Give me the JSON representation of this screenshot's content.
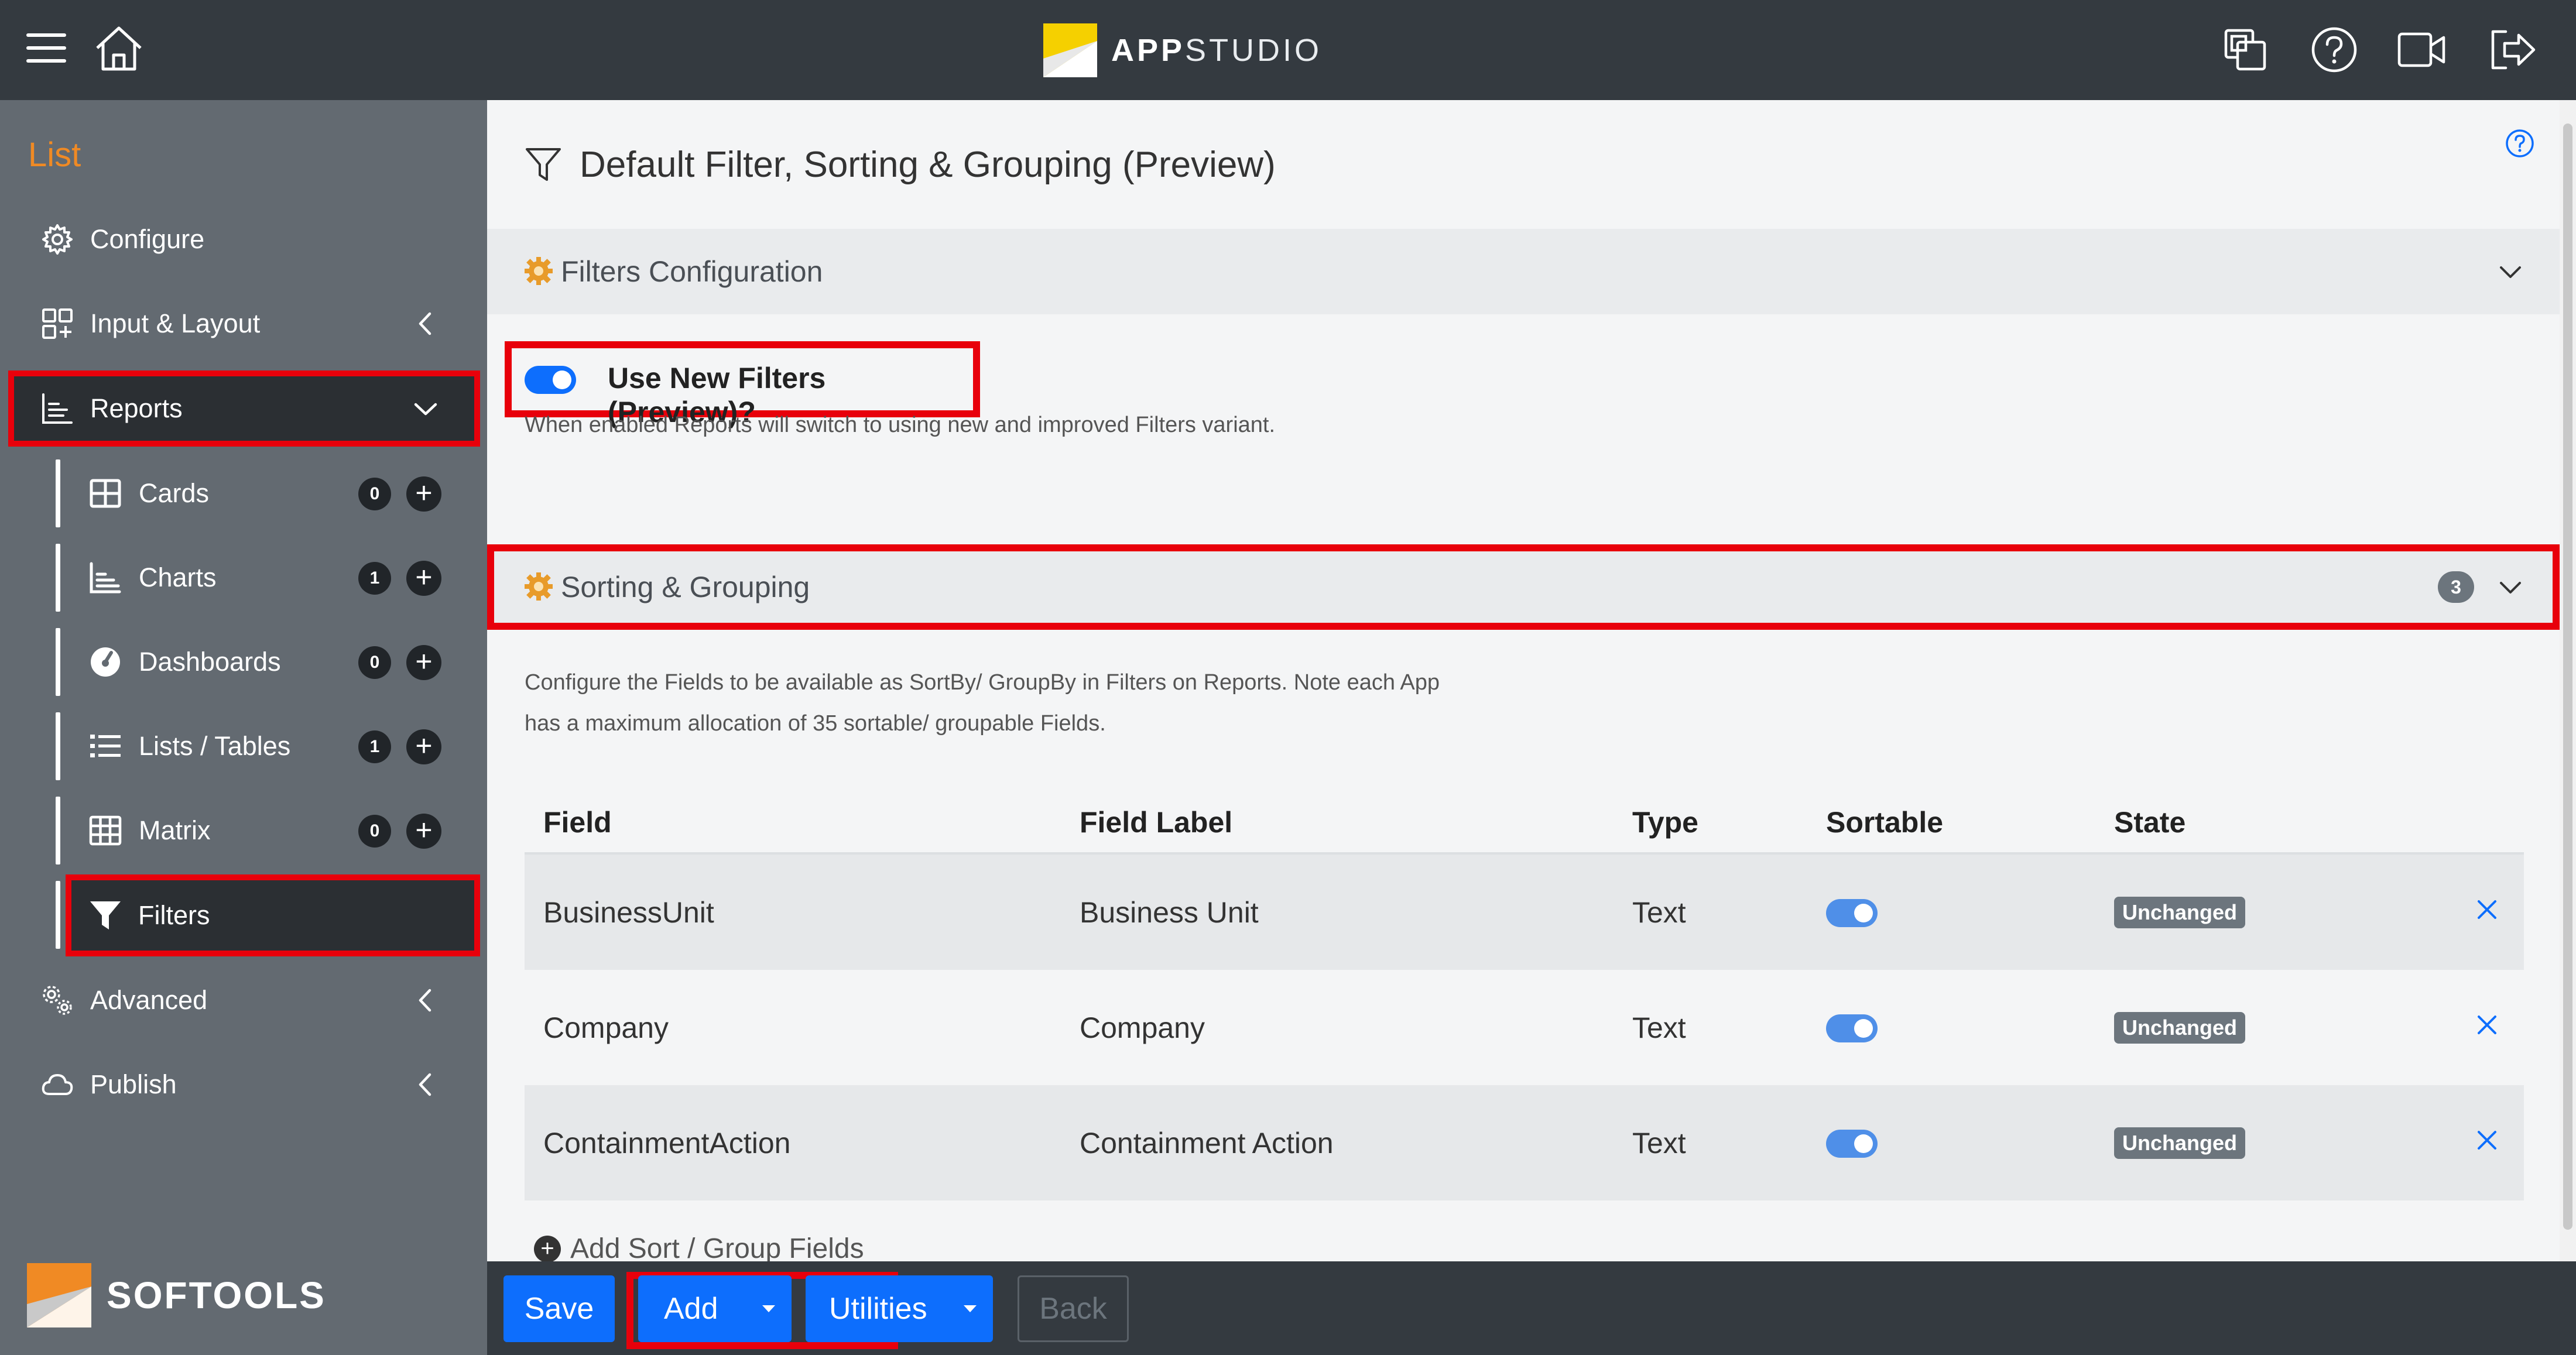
{
  "header": {
    "brand_bold": "APP",
    "brand_rest": "STUDIO",
    "icons": [
      "menu-icon",
      "home-icon",
      "copy-icon",
      "help-icon",
      "video-icon",
      "logout-icon"
    ],
    "brand_colors": {
      "yellow": "#f5d000",
      "white": "#ffffff"
    }
  },
  "sidebar": {
    "title": "List",
    "items": [
      {
        "label": "Configure",
        "icon": "gear-icon"
      },
      {
        "label": "Input & Layout",
        "icon": "layout-icon"
      },
      {
        "label": "Reports",
        "icon": "chart-icon"
      }
    ],
    "sub_items": [
      {
        "label": "Cards",
        "count": "0",
        "icon": "cards-icon"
      },
      {
        "label": "Charts",
        "count": "1",
        "icon": "chart-icon"
      },
      {
        "label": "Dashboards",
        "count": "0",
        "icon": "dashboard-icon"
      },
      {
        "label": "Lists / Tables",
        "count": "1",
        "icon": "list-icon"
      },
      {
        "label": "Matrix",
        "count": "0",
        "icon": "matrix-icon"
      },
      {
        "label": "Filters",
        "icon": "filter-icon"
      }
    ],
    "bottom_items": [
      {
        "label": "Advanced",
        "icon": "gears-icon"
      },
      {
        "label": "Publish",
        "icon": "cloud-icon"
      }
    ],
    "logo_text": "SOFTOOLS",
    "accent_color": "#f08a24"
  },
  "main": {
    "title": "Default Filter, Sorting & Grouping (Preview)",
    "filters_section": {
      "label": "Filters Configuration",
      "toggle_label": "Use New Filters (Preview)?",
      "toggle_on": true,
      "help": "When enabled Reports will switch to using new and improved Filters variant."
    },
    "sorting_section": {
      "label": "Sorting & Grouping",
      "count": "3",
      "help_line1": "Configure the Fields to be available as SortBy/ GroupBy in Filters on Reports. Note each App",
      "help_line2": "has a maximum allocation of 35 sortable/ groupable Fields."
    },
    "table": {
      "columns": [
        "Field",
        "Field Label",
        "Type",
        "Sortable",
        "State"
      ],
      "rows": [
        {
          "field": "BusinessUnit",
          "label": "Business Unit",
          "type": "Text",
          "sortable": true,
          "state": "Unchanged"
        },
        {
          "field": "Company",
          "label": "Company",
          "type": "Text",
          "sortable": true,
          "state": "Unchanged"
        },
        {
          "field": "ContainmentAction",
          "label": "Containment Action",
          "type": "Text",
          "sortable": true,
          "state": "Unchanged"
        }
      ]
    },
    "add_fields_label": "Add Sort / Group Fields"
  },
  "footer": {
    "save": "Save",
    "add": "Add",
    "utilities": "Utilities",
    "back": "Back",
    "primary_color": "#0d6efd",
    "highlight_color": "#e8000b"
  }
}
